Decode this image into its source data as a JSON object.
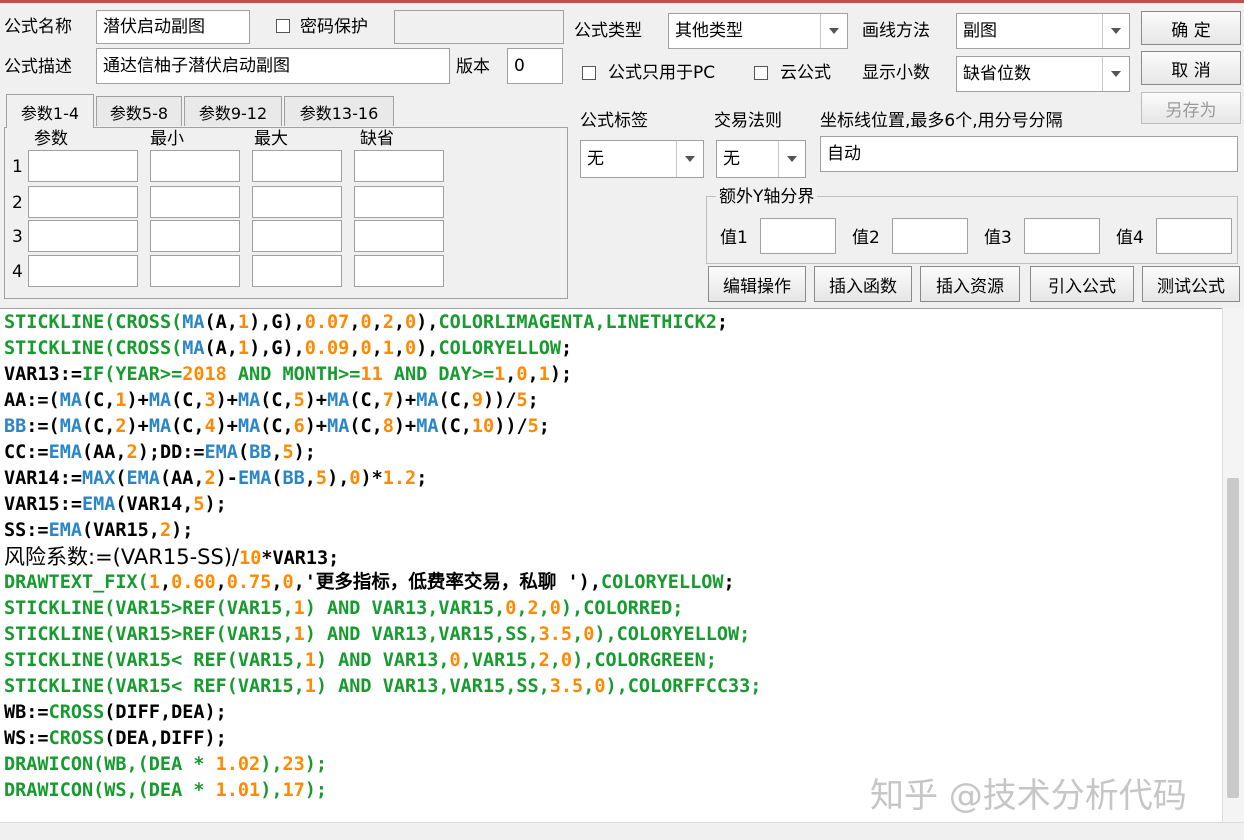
{
  "colors": {
    "code_green": "#179b2f",
    "code_blue": "#2b86c8",
    "code_orange": "#ff8a00",
    "code_text": "#000000",
    "accent_line": "#c0504d"
  },
  "header": {
    "name_label": "公式名称",
    "name_value": "潜伏启动副图",
    "password_label": "密码保护",
    "password_value": "",
    "desc_label": "公式描述",
    "desc_value": "通达信柚子潜伏启动副图",
    "version_label": "版本",
    "version_value": "0",
    "type_label": "公式类型",
    "type_value": "其他类型",
    "draw_label": "画线方法",
    "draw_value": "副图",
    "pc_only_label": "公式只用于PC",
    "cloud_label": "云公式",
    "decimal_label": "显示小数",
    "decimal_value": "缺省位数",
    "ok_label": "确  定",
    "cancel_label": "取  消",
    "saveas_label": "另存为"
  },
  "params": {
    "tabs": [
      "参数1-4",
      "参数5-8",
      "参数9-12",
      "参数13-16"
    ],
    "columns": [
      "参数",
      "最小",
      "最大",
      "缺省"
    ],
    "rows": [
      "1",
      "2",
      "3",
      "4"
    ]
  },
  "right_panel": {
    "tag_label": "公式标签",
    "tag_value": "无",
    "rule_label": "交易法则",
    "rule_value": "无",
    "coord_label": "坐标线位置,最多6个,用分号分隔",
    "coord_value": "自动",
    "yaxis_group": "额外Y轴分界",
    "v1_label": "值1",
    "v2_label": "值2",
    "v3_label": "值3",
    "v4_label": "值4",
    "buttons": [
      "编辑操作",
      "插入函数",
      "插入资源",
      "引入公式",
      "测试公式"
    ]
  },
  "code": [
    [
      [
        "STICKLINE(",
        "g"
      ],
      [
        "CROSS(",
        "g"
      ],
      [
        "MA",
        "b"
      ],
      [
        "(A,",
        "k"
      ],
      [
        "1",
        "o"
      ],
      [
        "),G),",
        "k"
      ],
      [
        "0.07",
        "o"
      ],
      [
        ",",
        "k"
      ],
      [
        "0",
        "o"
      ],
      [
        ",",
        "k"
      ],
      [
        "2",
        "o"
      ],
      [
        ",",
        "k"
      ],
      [
        "0",
        "o"
      ],
      [
        "),",
        "k"
      ],
      [
        "COLORLIMAGENTA,LINETHICK2",
        "g"
      ],
      [
        ";",
        "k"
      ]
    ],
    [
      [
        "STICKLINE(",
        "g"
      ],
      [
        "CROSS(",
        "g"
      ],
      [
        "MA",
        "b"
      ],
      [
        "(A,",
        "k"
      ],
      [
        "1",
        "o"
      ],
      [
        "),G),",
        "k"
      ],
      [
        "0.09",
        "o"
      ],
      [
        ",",
        "k"
      ],
      [
        "0",
        "o"
      ],
      [
        ",",
        "k"
      ],
      [
        "1",
        "o"
      ],
      [
        ",",
        "k"
      ],
      [
        "0",
        "o"
      ],
      [
        "),",
        "k"
      ],
      [
        "COLORYELLOW",
        "g"
      ],
      [
        ";",
        "k"
      ]
    ],
    [
      [
        "VAR13:=",
        "k"
      ],
      [
        "IF(YEAR>=",
        "g"
      ],
      [
        "2018",
        "o"
      ],
      [
        " AND MONTH>=",
        "g"
      ],
      [
        "11",
        "o"
      ],
      [
        " AND DAY>=",
        "g"
      ],
      [
        "1",
        "o"
      ],
      [
        ",",
        "k"
      ],
      [
        "0",
        "o"
      ],
      [
        ",",
        "k"
      ],
      [
        "1",
        "o"
      ],
      [
        ");",
        "k"
      ]
    ],
    [
      [
        "AA:=(",
        "k"
      ],
      [
        "MA",
        "b"
      ],
      [
        "(C,",
        "k"
      ],
      [
        "1",
        "o"
      ],
      [
        ")+",
        "k"
      ],
      [
        "MA",
        "b"
      ],
      [
        "(C,",
        "k"
      ],
      [
        "3",
        "o"
      ],
      [
        ")+",
        "k"
      ],
      [
        "MA",
        "b"
      ],
      [
        "(C,",
        "k"
      ],
      [
        "5",
        "o"
      ],
      [
        ")+",
        "k"
      ],
      [
        "MA",
        "b"
      ],
      [
        "(C,",
        "k"
      ],
      [
        "7",
        "o"
      ],
      [
        ")+",
        "k"
      ],
      [
        "MA",
        "b"
      ],
      [
        "(C,",
        "k"
      ],
      [
        "9",
        "o"
      ],
      [
        "))/",
        "k"
      ],
      [
        "5",
        "o"
      ],
      [
        ";",
        "k"
      ]
    ],
    [
      [
        "BB",
        "b"
      ],
      [
        ":=(",
        "k"
      ],
      [
        "MA",
        "b"
      ],
      [
        "(C,",
        "k"
      ],
      [
        "2",
        "o"
      ],
      [
        ")+",
        "k"
      ],
      [
        "MA",
        "b"
      ],
      [
        "(C,",
        "k"
      ],
      [
        "4",
        "o"
      ],
      [
        ")+",
        "k"
      ],
      [
        "MA",
        "b"
      ],
      [
        "(C,",
        "k"
      ],
      [
        "6",
        "o"
      ],
      [
        ")+",
        "k"
      ],
      [
        "MA",
        "b"
      ],
      [
        "(C,",
        "k"
      ],
      [
        "8",
        "o"
      ],
      [
        ")+",
        "k"
      ],
      [
        "MA",
        "b"
      ],
      [
        "(C,",
        "k"
      ],
      [
        "10",
        "o"
      ],
      [
        "))/",
        "k"
      ],
      [
        "5",
        "o"
      ],
      [
        ";",
        "k"
      ]
    ],
    [
      [
        "CC:=",
        "k"
      ],
      [
        "EMA",
        "b"
      ],
      [
        "(AA,",
        "k"
      ],
      [
        "2",
        "o"
      ],
      [
        ");DD:=",
        "k"
      ],
      [
        "EMA",
        "b"
      ],
      [
        "(",
        "k"
      ],
      [
        "BB",
        "b"
      ],
      [
        ",",
        "k"
      ],
      [
        "5",
        "o"
      ],
      [
        ");",
        "k"
      ]
    ],
    [
      [
        "VAR14:=",
        "k"
      ],
      [
        "MAX",
        "b"
      ],
      [
        "(",
        "k"
      ],
      [
        "EMA",
        "b"
      ],
      [
        "(AA,",
        "k"
      ],
      [
        "2",
        "o"
      ],
      [
        ")-",
        "k"
      ],
      [
        "EMA",
        "b"
      ],
      [
        "(",
        "k"
      ],
      [
        "BB",
        "b"
      ],
      [
        ",",
        "k"
      ],
      [
        "5",
        "o"
      ],
      [
        "),",
        "k"
      ],
      [
        "0",
        "o"
      ],
      [
        ")*",
        "k"
      ],
      [
        "1.2",
        "o"
      ],
      [
        ";",
        "k"
      ]
    ],
    [
      [
        "VAR15:=",
        "k"
      ],
      [
        "EMA",
        "b"
      ],
      [
        "(VAR14,",
        "k"
      ],
      [
        "5",
        "o"
      ],
      [
        ");",
        "k"
      ]
    ],
    [
      [
        "SS:=",
        "k"
      ],
      [
        "EMA",
        "b"
      ],
      [
        "(VAR15,",
        "k"
      ],
      [
        "2",
        "o"
      ],
      [
        ");",
        "k"
      ]
    ],
    [
      [
        "风险系数:=(VAR15-SS)/",
        "k"
      ],
      [
        "10",
        "o"
      ],
      [
        "*VAR13;",
        "k"
      ]
    ],
    [
      [
        "DRAWTEXT_FIX(",
        "g"
      ],
      [
        "1",
        "o"
      ],
      [
        ",",
        "k"
      ],
      [
        "0.60",
        "o"
      ],
      [
        ",",
        "k"
      ],
      [
        "0.75",
        "o"
      ],
      [
        ",",
        "k"
      ],
      [
        "0",
        "o"
      ],
      [
        ",'更多指标，低费率交易，私聊 '),",
        "k"
      ],
      [
        "COLORYELLOW",
        "g"
      ],
      [
        ";",
        "k"
      ]
    ],
    [
      [
        "STICKLINE(VAR15>REF(VAR15,",
        "g"
      ],
      [
        "1",
        "o"
      ],
      [
        ") AND VAR13,VAR15,",
        "g"
      ],
      [
        "0",
        "o"
      ],
      [
        ",",
        "g"
      ],
      [
        "2",
        "o"
      ],
      [
        ",",
        "g"
      ],
      [
        "0",
        "o"
      ],
      [
        "),COLORRED;",
        "g"
      ]
    ],
    [
      [
        "STICKLINE(VAR15>REF(VAR15,",
        "g"
      ],
      [
        "1",
        "o"
      ],
      [
        ") AND VAR13,VAR15,SS,",
        "g"
      ],
      [
        "3.5",
        "o"
      ],
      [
        ",",
        "g"
      ],
      [
        "0",
        "o"
      ],
      [
        "),COLORYELLOW;",
        "g"
      ]
    ],
    [
      [
        "STICKLINE(VAR15< REF(VAR15,",
        "g"
      ],
      [
        "1",
        "o"
      ],
      [
        ") AND VAR13,",
        "g"
      ],
      [
        "0",
        "o"
      ],
      [
        ",VAR15,",
        "g"
      ],
      [
        "2",
        "o"
      ],
      [
        ",",
        "g"
      ],
      [
        "0",
        "o"
      ],
      [
        "),COLORGREEN;",
        "g"
      ]
    ],
    [
      [
        "STICKLINE(VAR15< REF(VAR15,",
        "g"
      ],
      [
        "1",
        "o"
      ],
      [
        ") AND VAR13,VAR15,SS,",
        "g"
      ],
      [
        "3.5",
        "o"
      ],
      [
        ",",
        "g"
      ],
      [
        "0",
        "o"
      ],
      [
        "),COLORFFCC33;",
        "g"
      ]
    ],
    [
      [
        "WB:=",
        "k"
      ],
      [
        "CROSS",
        "g"
      ],
      [
        "(DIFF,DEA);",
        "k"
      ]
    ],
    [
      [
        "WS:=",
        "k"
      ],
      [
        "CROSS",
        "g"
      ],
      [
        "(DEA,DIFF);",
        "k"
      ]
    ],
    [
      [
        "DRAWICON(WB,(DEA * ",
        "g"
      ],
      [
        "1.02",
        "o"
      ],
      [
        "),",
        "g"
      ],
      [
        "23",
        "o"
      ],
      [
        ");",
        "g"
      ]
    ],
    [
      [
        "DRAWICON(WS,(DEA * ",
        "g"
      ],
      [
        "1.01",
        "o"
      ],
      [
        "),",
        "g"
      ],
      [
        "17",
        "o"
      ],
      [
        ");",
        "g"
      ]
    ]
  ],
  "watermark": "知乎 @技术分析代码"
}
